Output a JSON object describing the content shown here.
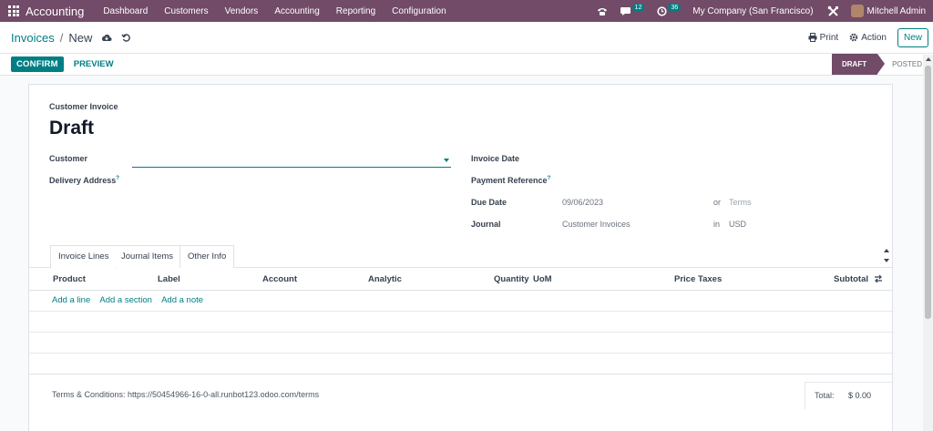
{
  "navbar": {
    "brand": "Accounting",
    "menu": [
      "Dashboard",
      "Customers",
      "Vendors",
      "Accounting",
      "Reporting",
      "Configuration"
    ],
    "messages_count": "12",
    "activities_count": "36",
    "company": "My Company (San Francisco)",
    "user": "Mitchell Admin"
  },
  "control_panel": {
    "breadcrumb_parent": "Invoices",
    "breadcrumb_separator": "/",
    "breadcrumb_current": "New",
    "print_label": "Print",
    "action_label": "Action",
    "new_label": "New"
  },
  "statusbar": {
    "confirm_label": "CONFIRM",
    "preview_label": "PREVIEW",
    "stages": [
      "DRAFT",
      "POSTED"
    ],
    "active_stage": "DRAFT"
  },
  "form": {
    "type_label": "Customer Invoice",
    "title": "Draft",
    "customer_label": "Customer",
    "delivery_label": "Delivery Address",
    "help_mark": "?",
    "invoice_date_label": "Invoice Date",
    "payment_ref_label": "Payment Reference",
    "due_date_label": "Due Date",
    "due_date_value": "09/06/2023",
    "or_label": "or",
    "terms_placeholder": "Terms",
    "journal_label": "Journal",
    "journal_value": "Customer Invoices",
    "in_label": "in",
    "currency_value": "USD"
  },
  "tabs": [
    "Invoice Lines",
    "Journal Items",
    "Other Info"
  ],
  "table": {
    "columns": [
      "Product",
      "Label",
      "Account",
      "Analytic",
      "Quantity",
      "UoM",
      "Price",
      "Taxes",
      "Subtotal"
    ],
    "add_line": "Add a line",
    "add_section": "Add a section",
    "add_note": "Add a note"
  },
  "footer": {
    "terms": "Terms & Conditions: https://50454966-16-0-all.runbot123.odoo.com/terms",
    "total_label": "Total:",
    "total_value": "$ 0.00"
  },
  "colors": {
    "brand": "#714b67",
    "accent": "#017e84"
  }
}
